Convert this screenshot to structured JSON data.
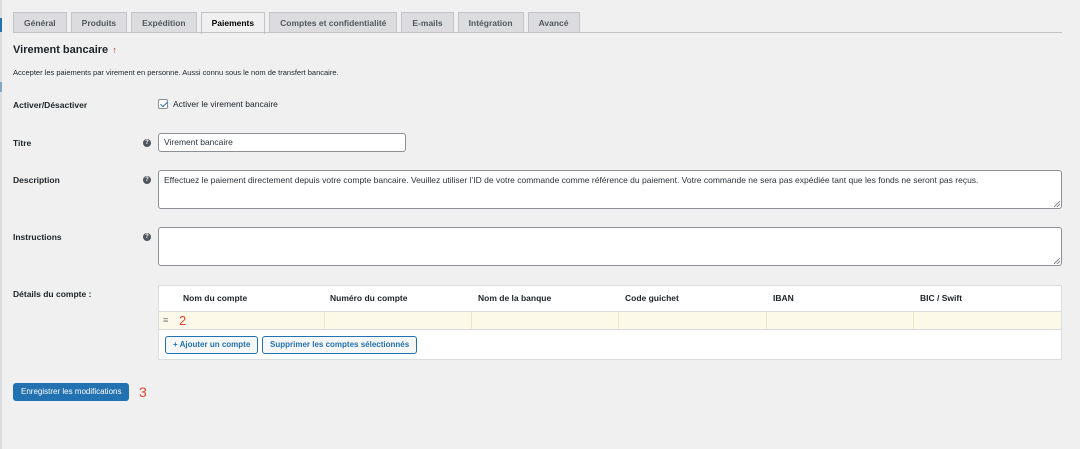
{
  "tabs": [
    {
      "label": "Général"
    },
    {
      "label": "Produits"
    },
    {
      "label": "Expédition"
    },
    {
      "label": "Paiements",
      "active": true
    },
    {
      "label": "Comptes et confidentialité"
    },
    {
      "label": "E-mails"
    },
    {
      "label": "Intégration"
    },
    {
      "label": "Avancé"
    }
  ],
  "section": {
    "title": "Virement bancaire",
    "title_icon": "up-arrow-icon",
    "description": "Accepter les paiements par virement en personne. Aussi connu sous le nom de transfert bancaire."
  },
  "fields": {
    "enable": {
      "label": "Activer/Désactiver",
      "checkbox_label": "Activer le virement bancaire",
      "checked": true
    },
    "title": {
      "label": "Titre",
      "value": "Virement bancaire"
    },
    "description": {
      "label": "Description",
      "value": "Effectuez le paiement directement depuis votre compte bancaire. Veuillez utiliser l’ID de votre commande comme référence du paiement. Votre commande ne sera pas expédiée tant que les fonds ne seront pas reçus."
    },
    "instructions": {
      "label": "Instructions",
      "value": ""
    },
    "accounts": {
      "label": "Détails du compte :",
      "columns": [
        "Nom du compte",
        "Numéro du compte",
        "Nom de la banque",
        "Code guichet",
        "IBAN",
        "BIC / Swift"
      ],
      "row_marker": "2",
      "add_button": "+ Ajouter un compte",
      "remove_button": "Supprimer les comptes sélectionnés"
    }
  },
  "save_button": "Enregistrer les modifications",
  "save_marker": "3",
  "colors": {
    "accent": "#2271b1",
    "highlight_row": "#fcf9e8",
    "annotation": "#e2442f"
  }
}
